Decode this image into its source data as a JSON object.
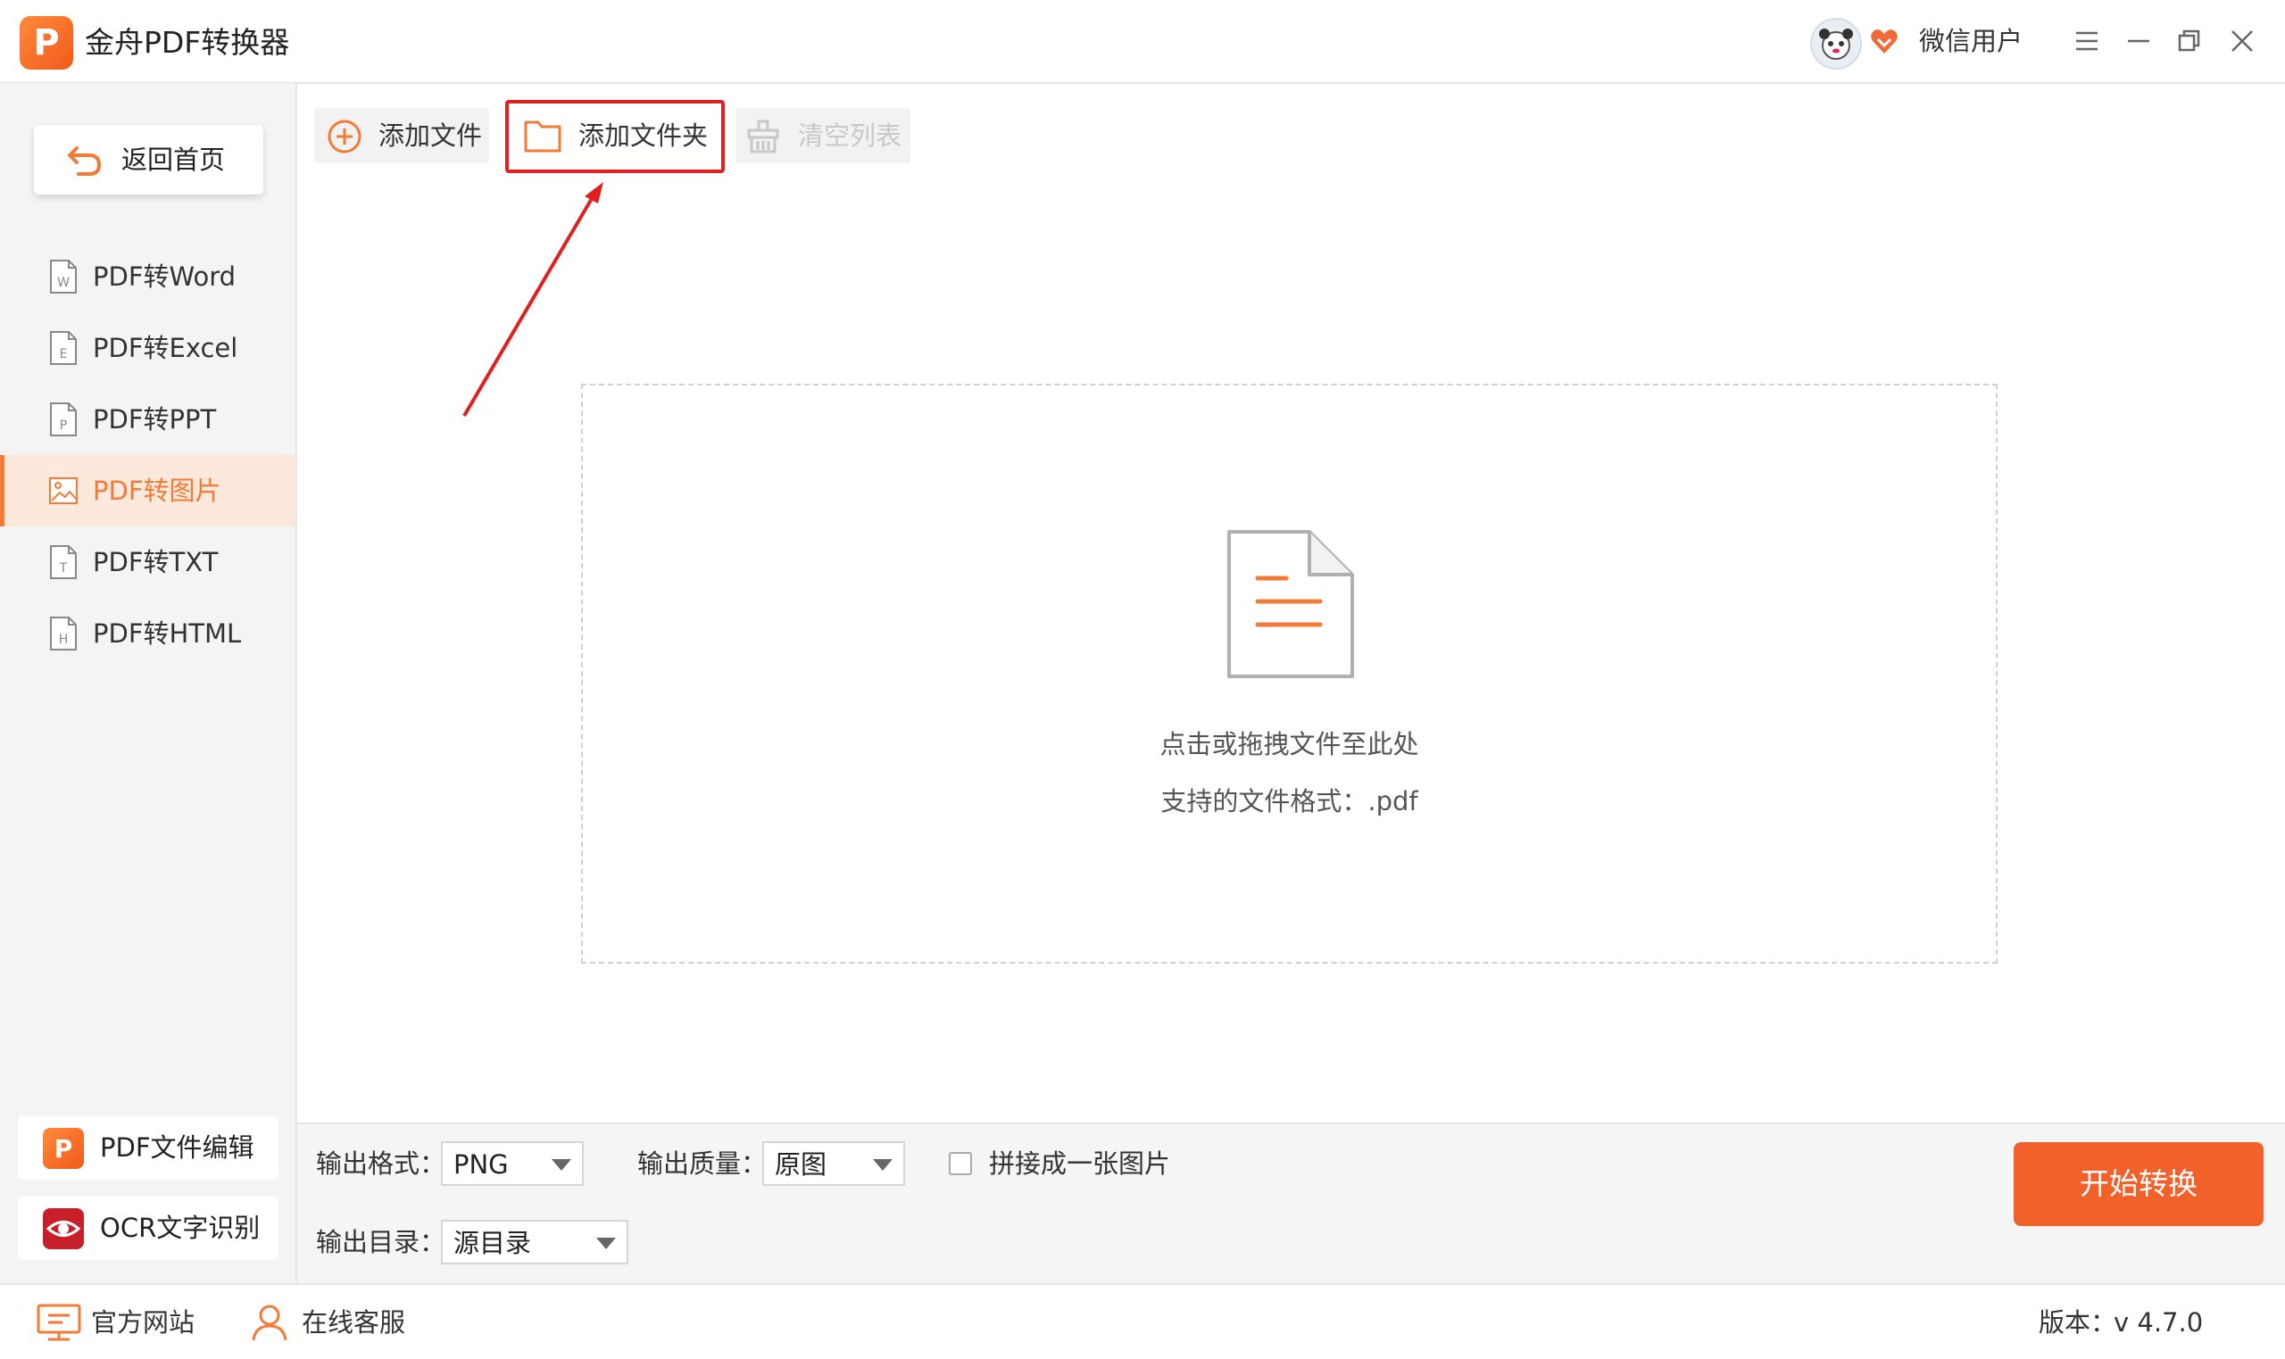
{
  "window": {
    "title": "金舟PDF转换器",
    "logo_letter": "P",
    "user_name": "微信用户",
    "controls": [
      "menu-icon",
      "minimize-icon",
      "restore-icon",
      "close-icon"
    ]
  },
  "sidebar": {
    "home_label": "返回首页",
    "items": [
      {
        "label": "PDF转Word",
        "icon_letter": "W",
        "active": false
      },
      {
        "label": "PDF转Excel",
        "icon_letter": "E",
        "active": false
      },
      {
        "label": "PDF转PPT",
        "icon_letter": "P",
        "active": false
      },
      {
        "label": "PDF转图片",
        "icon_letter": "",
        "active": true
      },
      {
        "label": "PDF转TXT",
        "icon_letter": "T",
        "active": false
      },
      {
        "label": "PDF转HTML",
        "icon_letter": "H",
        "active": false
      }
    ],
    "promos": [
      {
        "label": "PDF文件编辑",
        "icon": "pdf-editor-icon"
      },
      {
        "label": "OCR文字识别",
        "icon": "ocr-eye-icon"
      }
    ]
  },
  "toolbar": {
    "add_file": "添加文件",
    "add_folder": "添加文件夹",
    "clear_list": "清空列表"
  },
  "dropzone": {
    "hint": "点击或拖拽文件至此处",
    "formats": "支持的文件格式：.pdf"
  },
  "options": {
    "format_label": "输出格式：",
    "format_value": "PNG",
    "quality_label": "输出质量：",
    "quality_value": "原图",
    "merge_label": "拼接成一张图片",
    "merge_checked": false,
    "dir_label": "输出目录：",
    "dir_value": "源目录",
    "start_label": "开始转换"
  },
  "statusbar": {
    "website": "官方网站",
    "support": "在线客服",
    "version_label": "版本：",
    "version_value": "v 4.7.0"
  },
  "colors": {
    "accent": "#f47a37",
    "start_button": "#f3612b",
    "highlight": "#e02020"
  }
}
